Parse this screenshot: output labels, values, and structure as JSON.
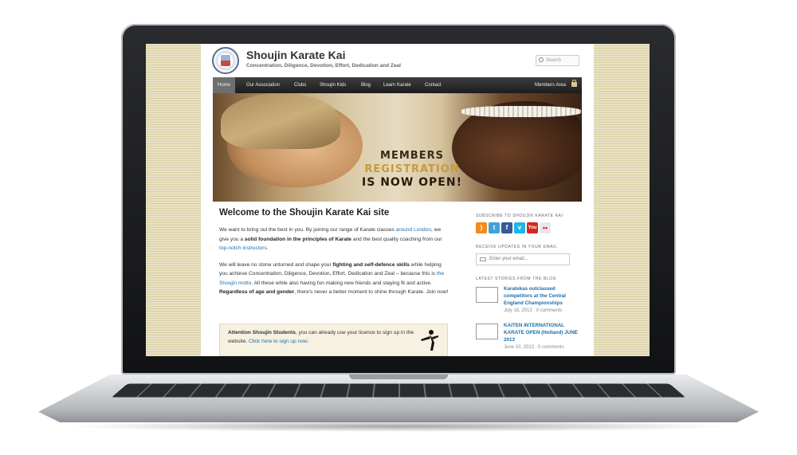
{
  "site": {
    "title": "Shoujin Karate Kai",
    "tagline": "Concentration, Diligence, Devotion, Effort, Dedication and Zeal",
    "search_placeholder": "Search"
  },
  "nav": {
    "items": [
      "Home",
      "Our Association",
      "Clubs",
      "Shoujin Kids",
      "Blog",
      "Learn Karate",
      "Contact"
    ],
    "active": "Home",
    "members": "Members Area"
  },
  "banner": {
    "line1": "MEMBERS",
    "line2": "REGISTRATION",
    "line3": "IS NOW OPEN!"
  },
  "main": {
    "heading": "Welcome to the Shoujin Karate Kai site",
    "p1": {
      "a": "We want to bring out the best in you. By joining our range of Karate classes ",
      "link1": "around London",
      "b": ", we give you a ",
      "bold": "solid foundation in the principles of Karate",
      "c": " and the best quality coaching from our ",
      "link2": "top-notch instructors",
      "d": "."
    },
    "p2": {
      "a": "We will leave no stone unturned and shape your ",
      "bold1": "fighting and self-defence skills",
      "b": " while helping you achieve Concentration, Diligence, Devotion, Effort, Dedication and Zeal – because this is ",
      "link": "the Shoujin motto",
      "c": ". All these while also having fun making new friends and staying fit and active. ",
      "bold2": "Regardless of age and gender",
      "d": ", there's never a better moment to shine through Karate. Join now!"
    },
    "callout": {
      "bold": "Attention Shoujin Students",
      "text": ", you can already use your licence to sign up in the website. ",
      "link": "Click here to sign up now",
      "end": "."
    }
  },
  "sidebar": {
    "subscribe_title": "SUBSCRIBE TO SHOUJIN KARATE KAI",
    "social": [
      {
        "name": "rss",
        "glyph": ")",
        "color": "#f28a1e"
      },
      {
        "name": "twitter",
        "glyph": "t",
        "color": "#3fa2d8"
      },
      {
        "name": "facebook",
        "glyph": "f",
        "color": "#3b5998"
      },
      {
        "name": "vimeo",
        "glyph": "v",
        "color": "#1ab7ea"
      },
      {
        "name": "youtube",
        "glyph": "You",
        "color": "#d8261f"
      },
      {
        "name": "flickr",
        "glyph": "••",
        "color": "#e8e8e8"
      }
    ],
    "email_title": "RECEIVE UPDATES IN YOUR EMAIL",
    "email_placeholder": "Enter your email...",
    "stories_title": "LATEST STORIES FROM THE BLOG",
    "stories": [
      {
        "title": "Karatekas outclassed competitors at the Central England Championships",
        "meta": "July 18, 2013 : 0 comments"
      },
      {
        "title": "KAITEN INTERNATIONAL KARATE OPEN (Holland) JUNE 2013",
        "meta": "June 10, 2013 : 0 comments"
      }
    ]
  }
}
